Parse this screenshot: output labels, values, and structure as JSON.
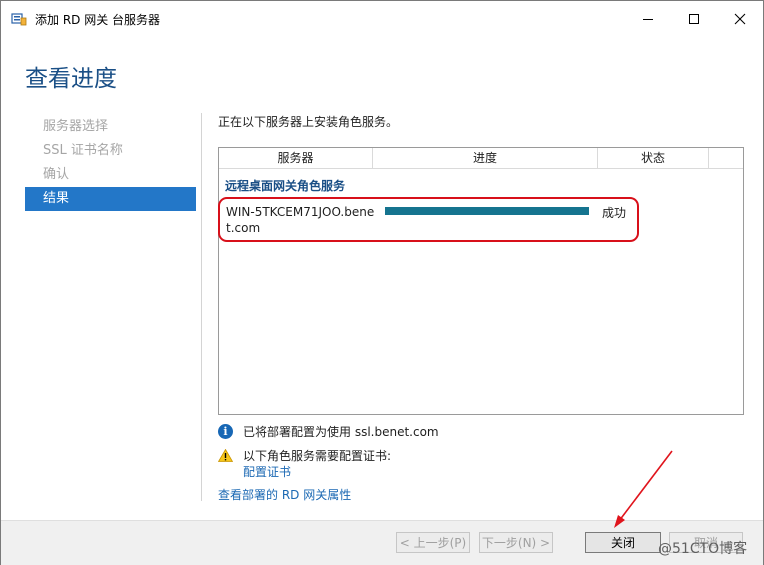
{
  "window": {
    "title": "添加 RD 网关 台服务器",
    "minimize_glyph": "—",
    "maximize_glyph": "☐",
    "close_glyph": "✕"
  },
  "page": {
    "heading": "查看进度"
  },
  "sidebar": {
    "items": [
      {
        "label": "服务器选择",
        "active": false
      },
      {
        "label": "SSL 证书名称",
        "active": false
      },
      {
        "label": "确认",
        "active": false
      },
      {
        "label": "结果",
        "active": true
      }
    ]
  },
  "main": {
    "intro": "正在以下服务器上安装角色服务。",
    "table": {
      "headers": [
        "服务器",
        "进度",
        "状态"
      ],
      "group": "远程桌面网关角色服务",
      "rows": [
        {
          "server_line1": "WIN-5TKCEM71JOO.bene",
          "server_line2": "t.com",
          "progress_percent": 100,
          "status": "成功"
        }
      ]
    },
    "info_text": "已将部署配置为使用 ssl.benet.com",
    "warning_text": "以下角色服务需要配置证书:",
    "warning_link": "配置证书",
    "properties_link": "查看部署的 RD 网关属性"
  },
  "footer": {
    "prev": "< 上一步(P)",
    "next": "下一步(N) >",
    "close": "关闭",
    "cancel": "取消"
  },
  "watermark": "@51CTO博客",
  "colors": {
    "accent": "#2377c8",
    "progress": "#15748f",
    "highlight": "#d8101a",
    "link": "#1b68b3"
  }
}
